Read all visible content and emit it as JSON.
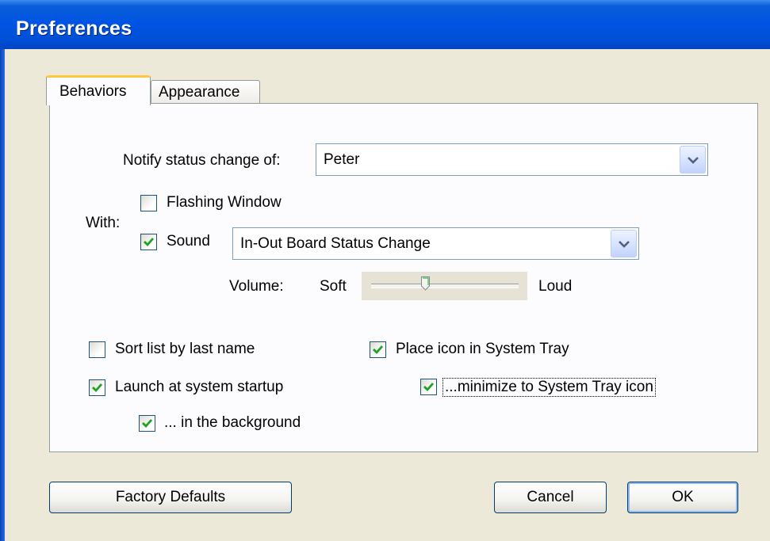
{
  "window": {
    "title": "Preferences"
  },
  "tabs": [
    {
      "label": "Behaviors",
      "active": true
    },
    {
      "label": "Appearance",
      "active": false
    }
  ],
  "notify": {
    "label": "Notify status change of:",
    "value": "Peter"
  },
  "with": {
    "label": "With:",
    "flashing_window": {
      "label": "Flashing Window",
      "checked": false
    },
    "sound": {
      "label": "Sound",
      "checked": true,
      "value": "In-Out Board Status Change"
    }
  },
  "volume": {
    "label": "Volume:",
    "min_label": "Soft",
    "max_label": "Loud",
    "level": 0.37
  },
  "options": {
    "sort_by_last_name": {
      "label": "Sort list by last name",
      "checked": false
    },
    "launch_at_startup": {
      "label": "Launch at system startup",
      "checked": true
    },
    "in_background": {
      "label": "... in the background",
      "checked": true
    },
    "place_icon_in_tray": {
      "label": "Place icon in System Tray",
      "checked": true
    },
    "minimize_to_tray": {
      "label": "...minimize to System Tray icon",
      "checked": true
    }
  },
  "buttons": {
    "factory_defaults": "Factory Defaults",
    "cancel": "Cancel",
    "ok": "OK"
  },
  "colors": {
    "titlebar": "#0054E3",
    "dialog_bg": "#ECE9D8",
    "check_mark": "#21A121",
    "active_tab_accent": "#FFC83C"
  }
}
